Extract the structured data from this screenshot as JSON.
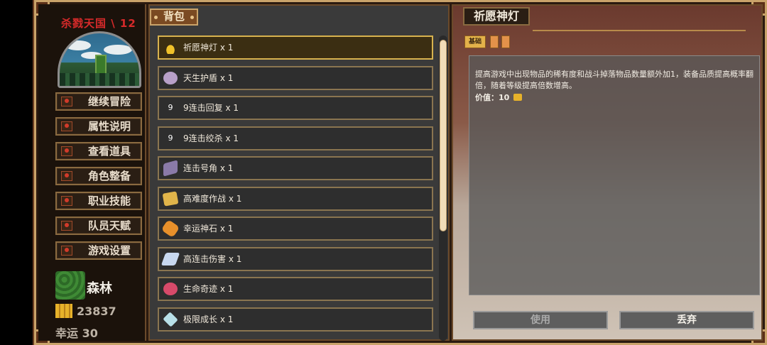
{
  "left_panel": {
    "stage": "杀戮天国 \\ 12",
    "menu": [
      {
        "label": "继续冒险",
        "icon": "red-emblem-icon"
      },
      {
        "label": "属性说明",
        "icon": "red-emblem-icon"
      },
      {
        "label": "查看道具",
        "icon": "red-emblem-icon"
      },
      {
        "label": "角色整备",
        "icon": "red-emblem-icon"
      },
      {
        "label": "职业技能",
        "icon": "red-emblem-icon"
      },
      {
        "label": "队员天赋",
        "icon": "red-emblem-icon"
      },
      {
        "label": "游戏设置",
        "icon": "red-emblem-icon"
      }
    ],
    "location": "森林",
    "gold": "23837",
    "luck": "幸运 30"
  },
  "backpack": {
    "tab_label": "背包",
    "items": [
      {
        "label": "祈愿神灯 x 1",
        "icon": "magic-lamp-icon",
        "color": "#f0c22a",
        "selected": true
      },
      {
        "label": "天生护盾 x 1",
        "icon": "shield-orb-icon",
        "color": "#b8a0c8"
      },
      {
        "label": "9连击回复 x 1",
        "icon": "nine-glyph-icon",
        "color": "#2e2e2e"
      },
      {
        "label": "9连击绞杀 x 1",
        "icon": "nine-glyph-icon",
        "color": "#2e2e2e"
      },
      {
        "label": "连击号角 x 1",
        "icon": "horn-icon",
        "color": "#8a7aa8"
      },
      {
        "label": "高难度作战 x 1",
        "icon": "scroll-map-icon",
        "color": "#e0b44a"
      },
      {
        "label": "幸运神石 x 1",
        "icon": "lucky-stone-icon",
        "color": "#e8902a"
      },
      {
        "label": "高连击伤害 x 1",
        "icon": "crystal-card-icon",
        "color": "#c8d8f0"
      },
      {
        "label": "生命奇迹 x 1",
        "icon": "life-orb-icon",
        "color": "#d84a6a"
      },
      {
        "label": "极限成长 x 1",
        "icon": "gem-icon",
        "color": "#b8e0e8"
      }
    ]
  },
  "detail": {
    "title": "祈愿神灯",
    "tab_basic": "基础",
    "description": "提高游戏中出现物品的稀有度和战斗掉落物品数量额外加1，装备品质提高概率翻倍，随着等级提高倍数增高。",
    "value_label": "价值：10",
    "use_button": "使用",
    "discard_button": "丢弃"
  }
}
